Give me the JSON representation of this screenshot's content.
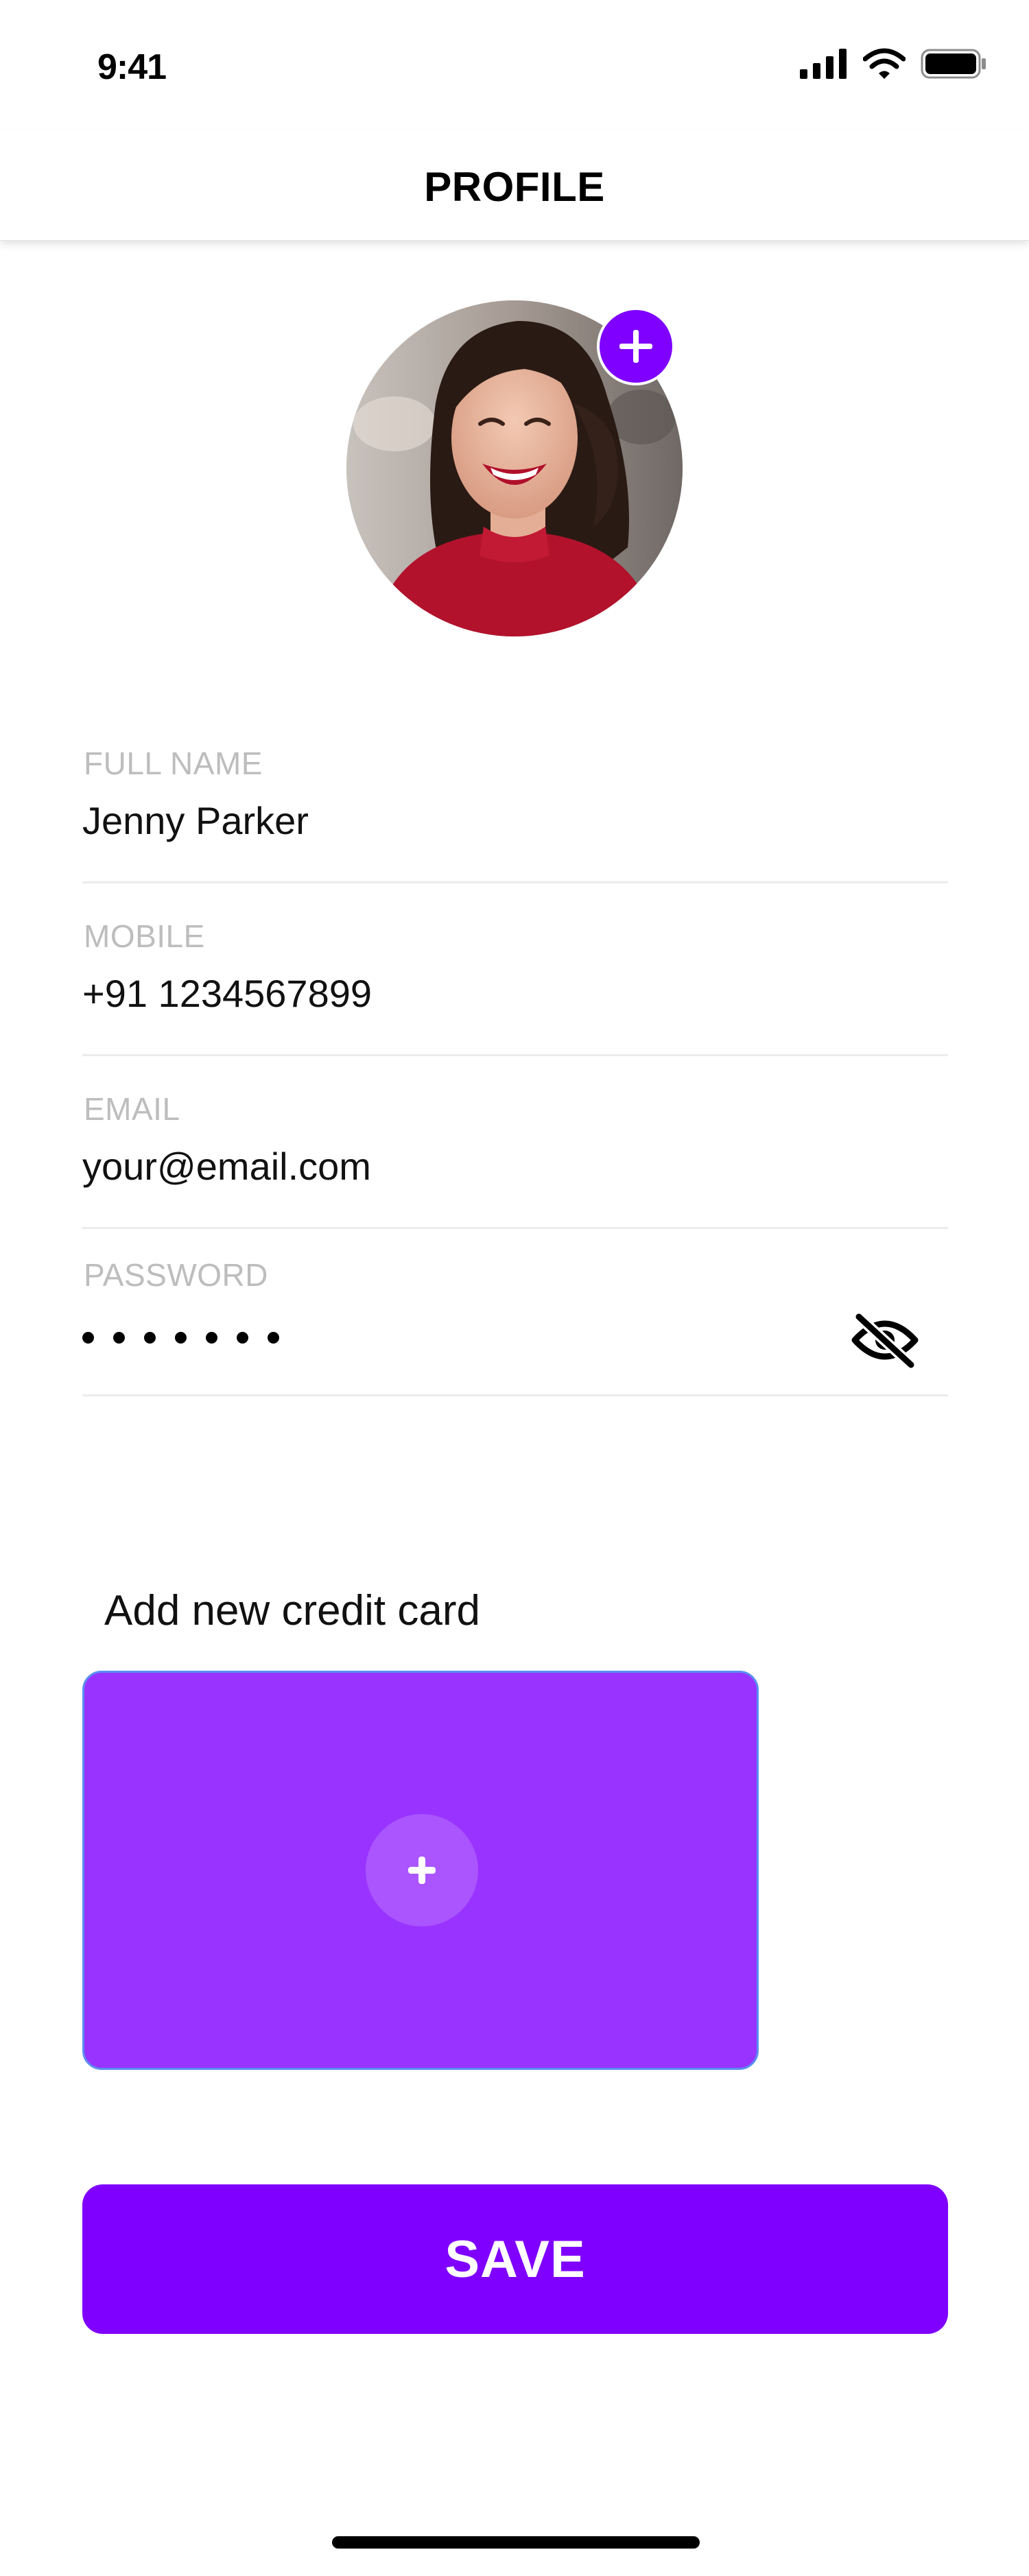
{
  "status_bar": {
    "time": "9:41"
  },
  "header": {
    "title": "PROFILE"
  },
  "avatar": {
    "add_icon": "plus-icon"
  },
  "form": {
    "full_name": {
      "label": "FULL NAME",
      "value": "Jenny Parker"
    },
    "mobile": {
      "label": "MOBILE",
      "value": "+91 1234567899"
    },
    "email": {
      "label": "EMAIL",
      "value": "your@email.com"
    },
    "password": {
      "label": "PASSWORD",
      "masked_length": 7,
      "toggle_icon": "eye-slash-icon"
    }
  },
  "credit_card": {
    "heading": "Add new credit card",
    "add_icon": "plus-icon"
  },
  "save_button": {
    "label": "SAVE"
  },
  "colors": {
    "accent": "#7f00ff",
    "card": "#9933ff",
    "label": "#bdbdbd"
  }
}
